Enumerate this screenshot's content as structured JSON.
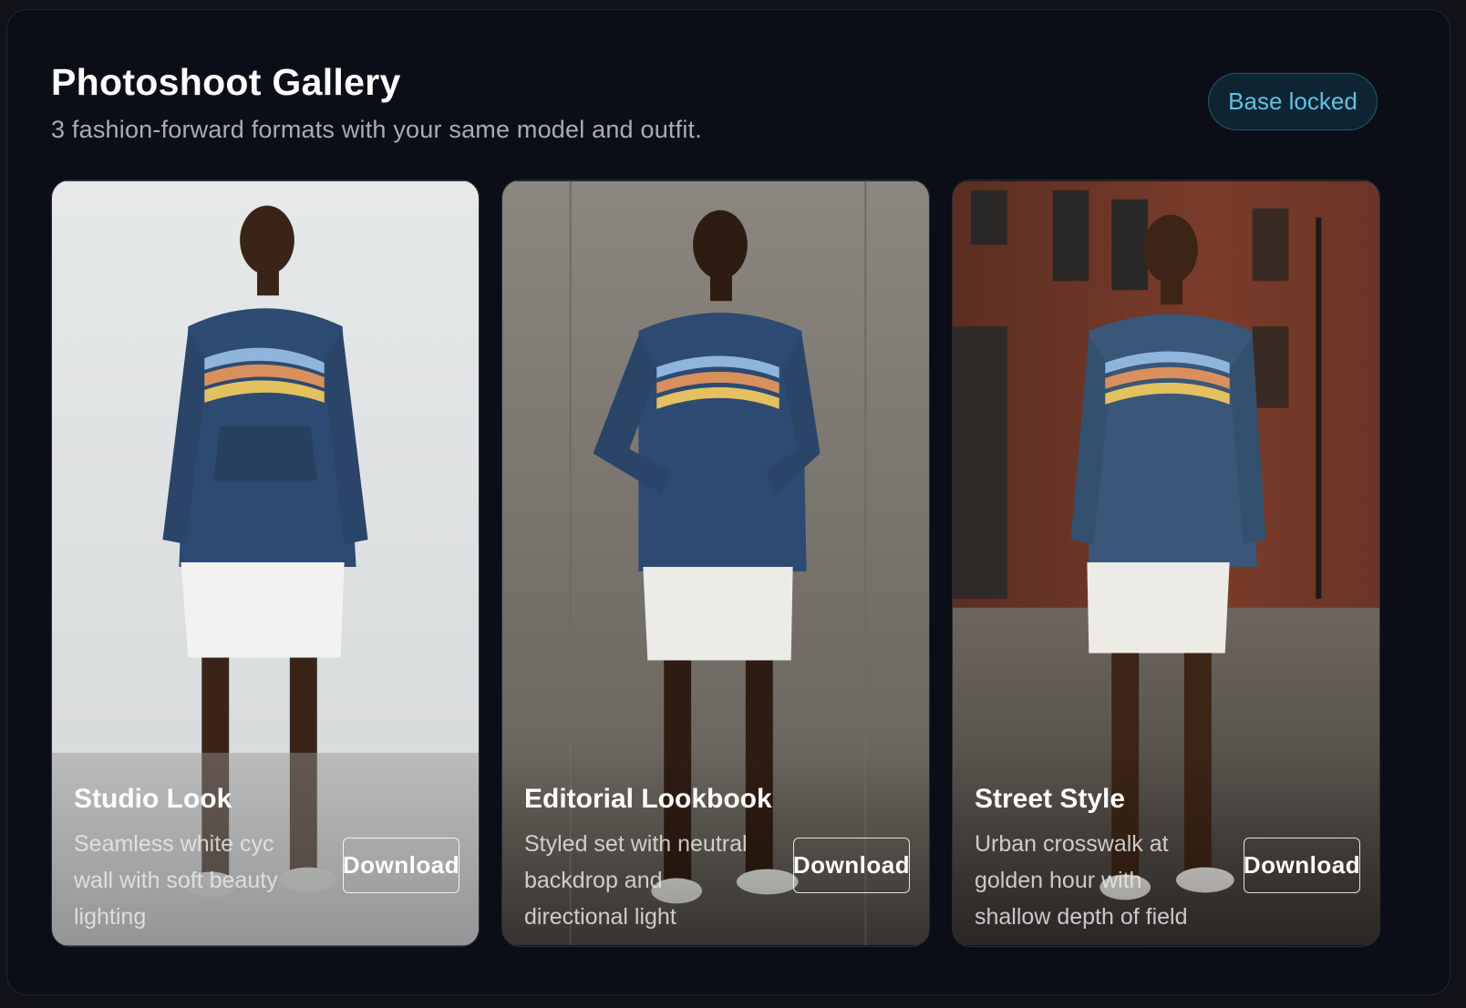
{
  "gallery": {
    "title": "Photoshoot Gallery",
    "subtitle": "3 fashion-forward formats with your same model and outfit.",
    "badge": "Base locked"
  },
  "cards": [
    {
      "title": "Studio Look",
      "description": "Seamless white cyc wall with soft beauty lighting",
      "button": "Download"
    },
    {
      "title": "Editorial Lookbook",
      "description": "Styled set with neutral backdrop and directional light",
      "button": "Download"
    },
    {
      "title": "Street Style",
      "description": "Urban crosswalk at golden hour with shallow depth of field",
      "button": "Download"
    }
  ],
  "colors": {
    "background": "#0b0e17",
    "badge_text": "#5ec2e4",
    "hoodie": "#2d4a72",
    "stripe_blue": "#8fb5dc",
    "stripe_orange": "#d9905c",
    "stripe_yellow": "#e3c15e"
  }
}
